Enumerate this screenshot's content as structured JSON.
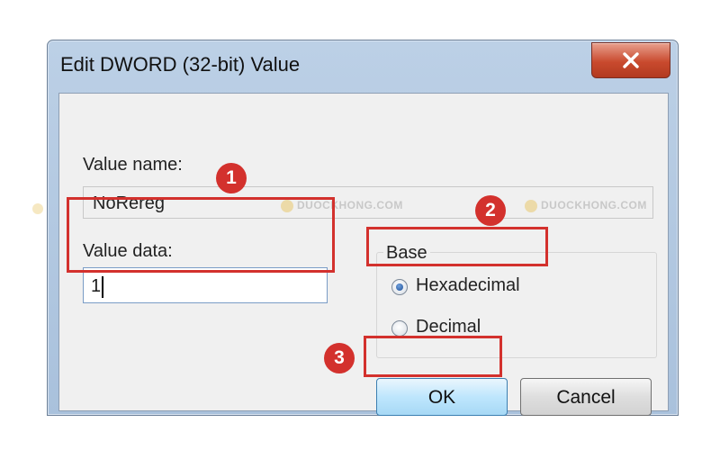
{
  "window": {
    "title": "Edit DWORD (32-bit) Value"
  },
  "value_name": {
    "label": "Value name:",
    "value": "NoRereg"
  },
  "value_data": {
    "label": "Value data:",
    "value": "1"
  },
  "base": {
    "legend": "Base",
    "options": [
      {
        "label": "Hexadecimal",
        "selected": true
      },
      {
        "label": "Decimal",
        "selected": false
      }
    ]
  },
  "buttons": {
    "ok": "OK",
    "cancel": "Cancel"
  },
  "annotations": {
    "markers": [
      "1",
      "2",
      "3"
    ],
    "color": "#d3312d"
  },
  "watermark": "DUOCKHONG.COM"
}
